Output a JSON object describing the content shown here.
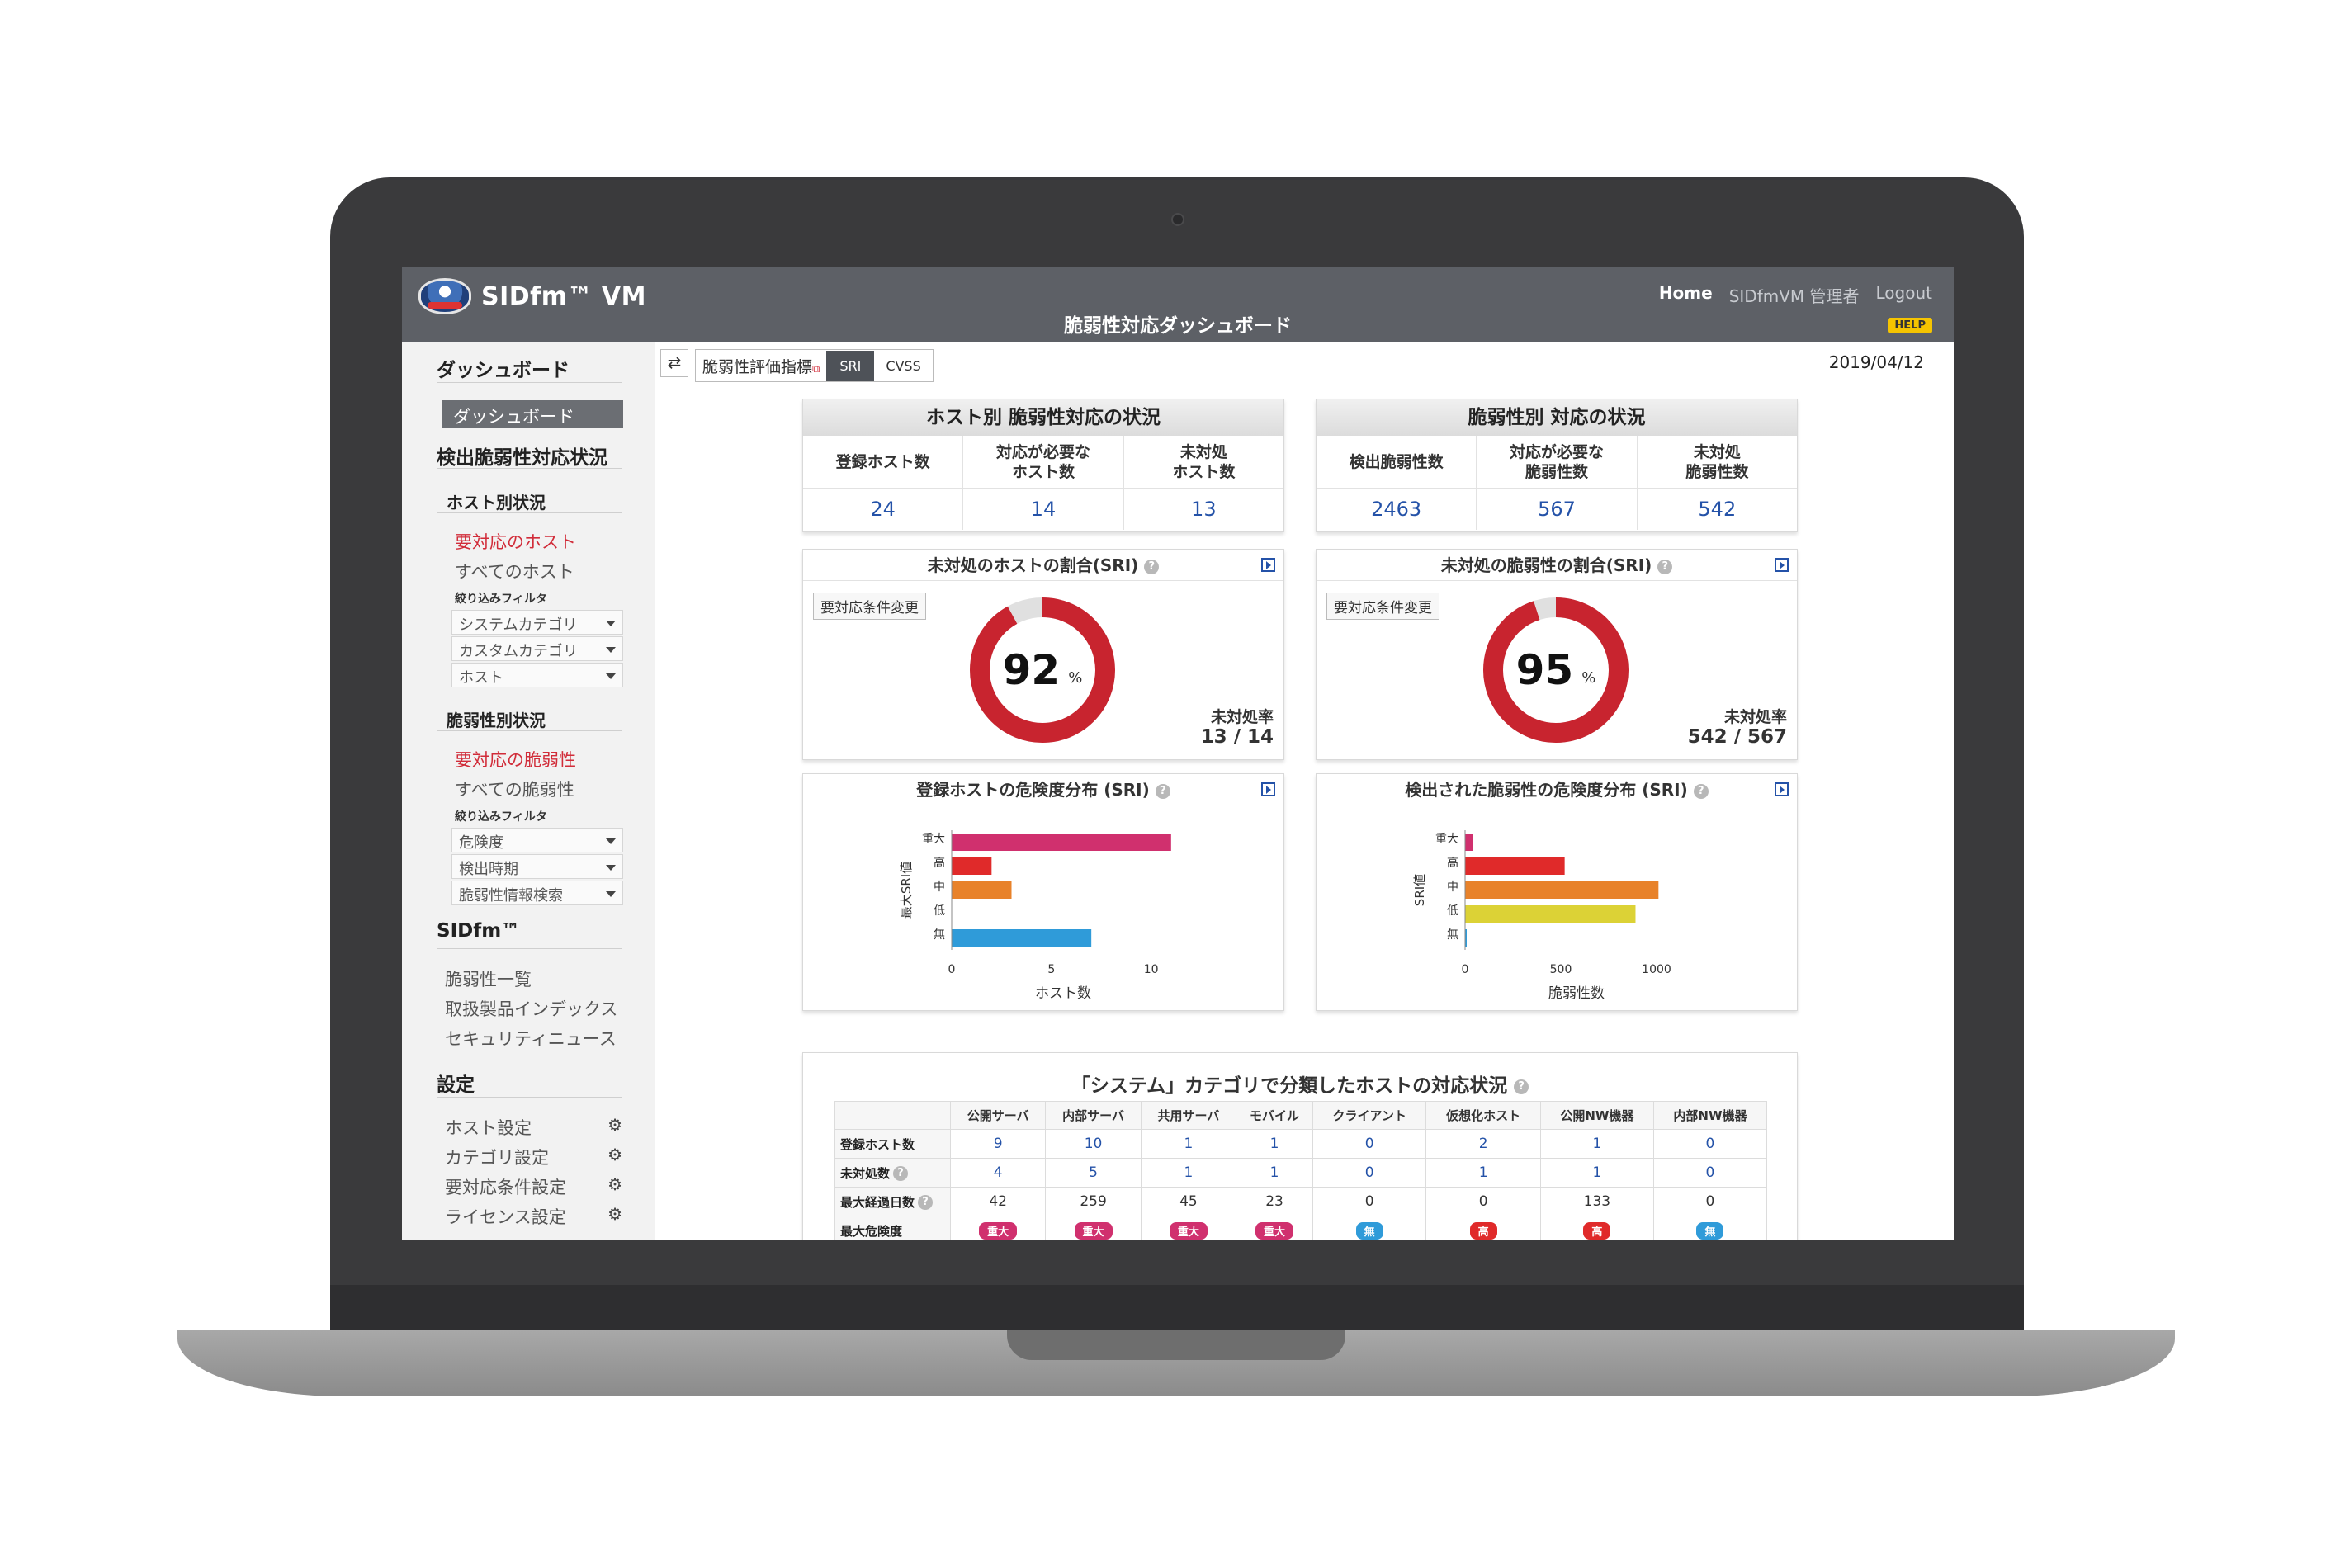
{
  "app": {
    "logo_text": "SIDfm™ VM",
    "page_title": "脆弱性対応ダッシュボード"
  },
  "top_nav": {
    "home": "Home",
    "user": "SIDfmVM 管理者",
    "logout": "Logout",
    "help": "HELP"
  },
  "sidebar": {
    "dashboard_section": "ダッシュボード",
    "dashboard_item": "ダッシュボード",
    "vuln_status_section": "検出脆弱性対応状況",
    "host_status": "ホスト別状況",
    "host_required": "要対応のホスト",
    "host_all": "すべてのホスト",
    "host_filter_label": "絞り込みフィルタ",
    "host_filters": [
      "システムカテゴリ",
      "カスタムカテゴリ",
      "ホスト"
    ],
    "vuln_status": "脆弱性別状況",
    "vuln_required": "要対応の脆弱性",
    "vuln_all": "すべての脆弱性",
    "vuln_filter_label": "絞り込みフィルタ",
    "vuln_filters": [
      "危険度",
      "検出時期",
      "脆弱性情報検索"
    ],
    "sidfm_section": "SIDfm™",
    "sidfm_items": [
      "脆弱性一覧",
      "取扱製品インデックス",
      "セキュリティニュース"
    ],
    "settings_section": "設定",
    "settings_items": [
      "ホスト設定",
      "カテゴリ設定",
      "要対応条件設定",
      "ライセンス設定"
    ]
  },
  "toolbar": {
    "toggle_icon": "⇄",
    "metric_label": "脆弱性評価指標",
    "metric_sri": "SRI",
    "metric_cvss": "CVSS",
    "date": "2019/04/12"
  },
  "host_summary": {
    "title": "ホスト別 脆弱性対応の状況",
    "headers": [
      "登録ホスト数",
      "対応が必要な\nホスト数",
      "未対処\nホスト数"
    ],
    "values": [
      "24",
      "14",
      "13"
    ]
  },
  "vuln_summary": {
    "title": "脆弱性別 対応の状況",
    "headers": [
      "検出脆弱性数",
      "対応が必要な\n脆弱性数",
      "未対処\n脆弱性数"
    ],
    "values": [
      "2463",
      "567",
      "542"
    ]
  },
  "host_rate": {
    "title": "未対処のホストの割合(SRI)",
    "button": "要対応条件変更",
    "percent": 92,
    "percent_text": "92",
    "unit": "%",
    "rate_label": "未対処率",
    "rate_value": "13 / 14"
  },
  "vuln_rate": {
    "title": "未対処の脆弱性の割合(SRI)",
    "button": "要対応条件変更",
    "percent": 95,
    "percent_text": "95",
    "unit": "%",
    "rate_label": "未対処率",
    "rate_value": "542 / 567"
  },
  "colors": {
    "donut": "#c8242f",
    "donut_track": "#e0e0e0",
    "critical": "#d0306e",
    "high": "#e02a2a",
    "medium": "#e8822a",
    "low": "#dcd236",
    "none": "#2f9bd9"
  },
  "chart_data": [
    {
      "type": "bar",
      "title": "登録ホストの危険度分布 (SRI)",
      "categories": [
        "重大",
        "高",
        "中",
        "低",
        "無"
      ],
      "values": [
        11,
        2,
        3,
        0,
        7
      ],
      "xlabel": "ホスト数",
      "ylabel": "最大SRI値",
      "xlim": [
        0,
        12
      ],
      "xticks": [
        "0",
        "5",
        "10"
      ],
      "orientation": "horizontal"
    },
    {
      "type": "bar",
      "title": "検出された脆弱性の危険度分布 (SRI)",
      "categories": [
        "重大",
        "高",
        "中",
        "低",
        "無"
      ],
      "values": [
        40,
        520,
        1010,
        890,
        5
      ],
      "xlabel": "脆弱性数",
      "ylabel": "SRI値",
      "xlim": [
        0,
        1250
      ],
      "xticks": [
        "0",
        "500",
        "1000"
      ],
      "orientation": "horizontal"
    }
  ],
  "category_table": {
    "title": "「システム」カテゴリで分類したホストの対応状況",
    "columns": [
      "公開サーバ",
      "内部サーバ",
      "共用サーバ",
      "モバイル",
      "クライアント",
      "仮想化ホスト",
      "公開NW機器",
      "内部NW機器"
    ],
    "row_labels": [
      "登録ホスト数",
      "未対処数",
      "最大経過日数",
      "最大危険度"
    ],
    "registered": [
      "9",
      "10",
      "1",
      "1",
      "0",
      "2",
      "1",
      "0"
    ],
    "unhandled": [
      "4",
      "5",
      "1",
      "1",
      "0",
      "1",
      "1",
      "0"
    ],
    "max_days": [
      "42",
      "259",
      "45",
      "23",
      "0",
      "0",
      "133",
      "0"
    ],
    "max_severity": [
      "重大",
      "重大",
      "重大",
      "重大",
      "無",
      "高",
      "高",
      "無"
    ]
  }
}
